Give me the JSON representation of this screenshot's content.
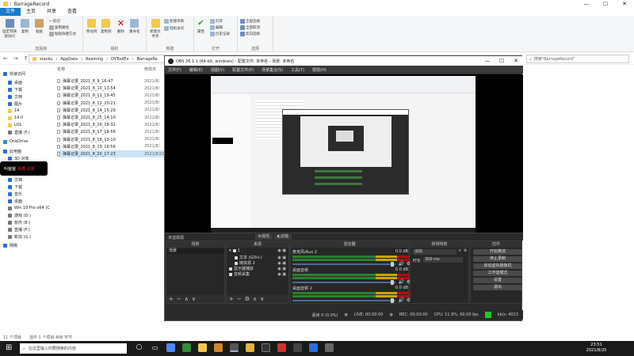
{
  "explorer": {
    "title": "BarrageRecord",
    "ribbon_tabs": [
      "文件",
      "主页",
      "共享",
      "查看"
    ],
    "ribbon": {
      "clipboard": {
        "label": "剪贴板",
        "pin": "固定到快速访问",
        "copy": "复制",
        "paste": "粘贴",
        "cut": "剪切",
        "copy_path": "复制路径",
        "paste_shortcut": "粘贴快捷方式"
      },
      "organize": {
        "label": "组织",
        "move_to": "移动到",
        "copy_to": "复制到",
        "delete": "删除",
        "rename": "重命名"
      },
      "new": {
        "label": "新建",
        "new_folder": "新建文件夹",
        "new_item": "新建项目",
        "easy_access": "轻松访问"
      },
      "open": {
        "label": "打开",
        "properties": "属性",
        "open": "打开",
        "edit": "编辑",
        "history": "历史记录"
      },
      "select": {
        "label": "选择",
        "select_all": "全部选择",
        "select_none": "全部取消",
        "invert": "反向选择"
      }
    },
    "breadcrumb": [
      "xiaoku",
      "AppData",
      "Roaming",
      "DYToolEx",
      "BarrageRe"
    ],
    "search_placeholder": "搜索\"BarrageRecord\"",
    "nav_items": [
      "快速访问",
      "桌面",
      "下载",
      "文档",
      "图片",
      "14",
      "14.0",
      "LOL",
      "直播 (F:)",
      "OneDrive",
      "此电脑",
      "3D 对象",
      "视频",
      "图片",
      "文档",
      "下载",
      "音乐",
      "桌面",
      "Win 10 Pro x64 (C",
      "游戏 (D:)",
      "软件 (E:)",
      "直播 (F:)",
      "新加 (G:)",
      "网络"
    ],
    "columns": {
      "name": "名称",
      "date": "修改日"
    },
    "files": [
      {
        "name": "弹幕记录_2021_8_9_16-47",
        "date": "2021/8/"
      },
      {
        "name": "弹幕记录_2021_8_10_13-54",
        "date": "2021/8/"
      },
      {
        "name": "弹幕记录_2021_8_11_19-45",
        "date": "2021/8/"
      },
      {
        "name": "弹幕记录_2021_8_12_20-21",
        "date": "2021/8/"
      },
      {
        "name": "弹幕记录_2021_8_14_15-29",
        "date": "2021/8/"
      },
      {
        "name": "弹幕记录_2021_8_15_14-10",
        "date": "2021/8/"
      },
      {
        "name": "弹幕记录_2021_8_16_19-32",
        "date": "2021/8/"
      },
      {
        "name": "弹幕记录_2021_8_17_19-56",
        "date": "2021/8/"
      },
      {
        "name": "弹幕记录_2021_8_18_13-10",
        "date": "2021/8/"
      },
      {
        "name": "弹幕记录_2021_8_19_16-56",
        "date": "2021/8/"
      },
      {
        "name": "弹幕记录_2021_8_20_17-23",
        "date": "2021/8/20"
      }
    ],
    "status": {
      "count": "11 个项目",
      "selected": "选中 1 个项目  408 字节"
    }
  },
  "popup": {
    "prefix": "叫爸爸",
    "highlight": "道德·沦丧"
  },
  "obs": {
    "title": "OBS 26.1.1 (64-bit, windows) - 配置文件: 未命名 - 场景: 未命名",
    "menu": [
      "文件(F)",
      "编辑(E)",
      "视图(V)",
      "配置文件(P)",
      "场景集合(S)",
      "工具(T)",
      "帮助(H)"
    ],
    "preview_source_bar": {
      "label": "未选择源",
      "properties": "属性",
      "filters": "滤镜"
    },
    "docks": {
      "scenes": "场景",
      "sources": "来源",
      "mixer": "混音器",
      "transitions": "转场特效",
      "controls": "控件"
    },
    "scene_item": "场景",
    "sources": [
      "文本 (GDI+)",
      "媒体源 2",
      "显示器捕获",
      "音频采集"
    ],
    "mixer_channels": [
      {
        "name": "麦克风/Aux 2",
        "db": "0.0 dB"
      },
      {
        "name": "桌面音频",
        "db": "0.0 dB"
      },
      {
        "name": "桌面音频 2",
        "db": "0.0 dB"
      }
    ],
    "transition": {
      "type": "淡出",
      "duration_label": "时长",
      "duration_value": "300 ms"
    },
    "controls": [
      "开始推流",
      "停止录制",
      "启动虚拟摄像机",
      "工作室模式",
      "设置",
      "退出"
    ],
    "status": {
      "dropped": "丢帧 0 (0.0%)",
      "live": "LIVE: 00:00:00",
      "rec": "REC: 00:00:00",
      "cpu": "CPU: 11.9%, 60.00 fps",
      "bitrate": "kb/s: 4013"
    }
  },
  "taskbar": {
    "search_placeholder": "在这里输入你要搜索的内容",
    "time": "23:51",
    "date": "2021/8/20"
  },
  "colors": {
    "accent": "#1979ca",
    "obs_bg": "#2b2b2b",
    "highlight_red": "#ff2a2a"
  }
}
